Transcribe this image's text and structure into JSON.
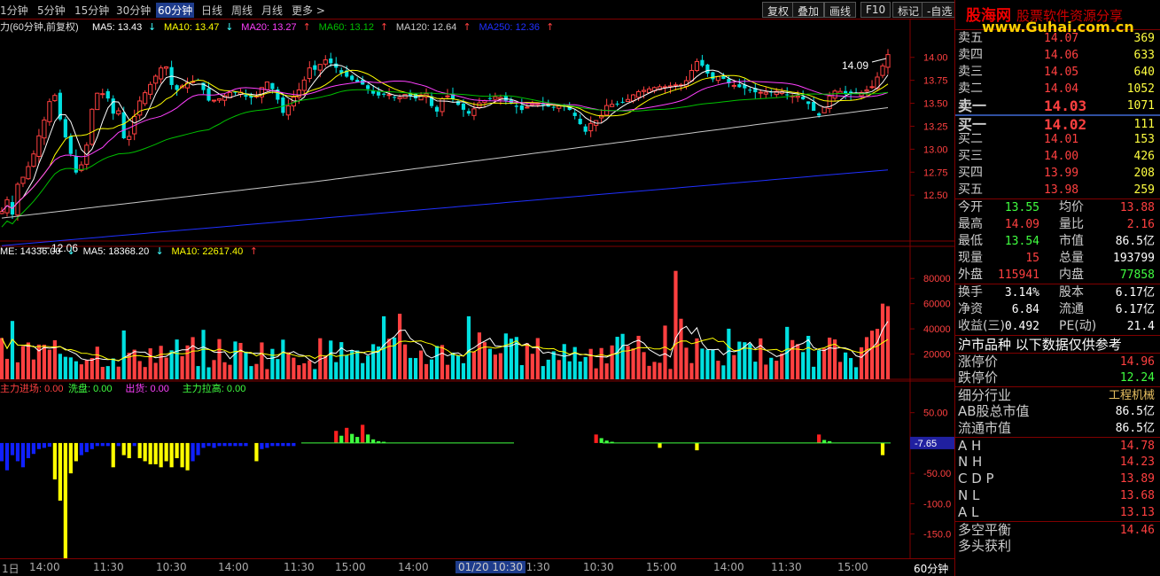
{
  "toolbar": {
    "periods": [
      "1分钟",
      "5分钟",
      "15分钟",
      "30分钟",
      "60分钟",
      "日线",
      "周线",
      "月线",
      "更多 >"
    ],
    "selected_period": "60分钟",
    "buttons": [
      "复权",
      "叠加",
      "画线",
      "F10",
      "标记",
      "-自选"
    ]
  },
  "colors": {
    "up": "#ff4040",
    "down": "#00e0e0",
    "ma5": "#ffffff",
    "ma10": "#ffff00",
    "ma20": "#ff40ff",
    "ma60": "#00c000",
    "ma120": "#c8c8c8",
    "ma250": "#2030ff",
    "bg": "#000000",
    "grid": "#800000"
  },
  "price_header": {
    "title": "力(60分钟,前复权)",
    "items": [
      {
        "label": "MA5: 13.43",
        "arrow": "↓",
        "color": "#ffffff"
      },
      {
        "label": "MA10: 13.47",
        "arrow": "↓",
        "color": "#ffff00"
      },
      {
        "label": "MA20: 13.27",
        "arrow": "↑",
        "color": "#ff40ff"
      },
      {
        "label": "MA60: 13.12",
        "arrow": "↑",
        "color": "#00c000"
      },
      {
        "label": "MA120: 12.64",
        "arrow": "↑",
        "color": "#c8c8c8"
      },
      {
        "label": "MA250: 12.36",
        "arrow": "↑",
        "color": "#2030ff"
      }
    ]
  },
  "volume_header": {
    "items": [
      {
        "label": "ME: 14336.00",
        "arrow": "↓",
        "color": "#ffffff"
      },
      {
        "label": "MA5: 18368.20",
        "arrow": "↓",
        "color": "#ffffff"
      },
      {
        "label": "MA10: 22617.40",
        "arrow": "↑",
        "color": "#ffff00"
      }
    ]
  },
  "indicator_header": {
    "items": [
      {
        "label": "主力进场: 0.00",
        "color": "#ff4040"
      },
      {
        "label": "洗盘: 0.00",
        "color": "#40ff40"
      },
      {
        "label": "出货: 0.00",
        "color": "#ff40ff"
      },
      {
        "label": "主力拉高: 0.00",
        "color": "#40ff40"
      }
    ]
  },
  "indicator_current": "-7.65",
  "price_axis": [
    "14.00",
    "13.75",
    "13.50",
    "13.25",
    "13.00",
    "12.75",
    "12.50"
  ],
  "volume_axis": [
    "80000",
    "60000",
    "40000",
    "20000"
  ],
  "indicator_axis": [
    "50.00",
    "-50.00",
    "-100.0",
    "-150.0"
  ],
  "annotations": {
    "high": "14.09",
    "low": "12.06"
  },
  "time_axis": [
    "1日",
    "14:00",
    "11:30",
    "10:30",
    "14:00",
    "11:30",
    "15:00",
    "14:00",
    "15:00",
    "11:30",
    "10:30",
    "15:00",
    "14:00",
    "11:30",
    "15:00"
  ],
  "cursor_time": "01/20 10:30",
  "period_label": "60分钟",
  "chart_data": {
    "type": "candlestick",
    "period": "60分钟",
    "ylim": [
      12.0,
      14.2
    ],
    "volume_ylim": [
      0,
      90000
    ],
    "indicator_ylim": [
      -190,
      70
    ],
    "high": 14.09,
    "low": 12.06,
    "ma_last": {
      "MA5": 13.43,
      "MA10": 13.47,
      "MA20": 13.27,
      "MA60": 13.12,
      "MA120": 12.64,
      "MA250": 12.36
    },
    "volume_last": 14336,
    "volume_ma5": 18368.2,
    "volume_ma10": 22617.4
  },
  "panel": {
    "logo": {
      "brand": "股海网",
      "slogan": "股票软件资源分享",
      "url": "www.Guhai.com.cn"
    },
    "order_book": [
      {
        "label": "卖五",
        "price": "14.07",
        "vol": "369"
      },
      {
        "label": "卖四",
        "price": "14.06",
        "vol": "633"
      },
      {
        "label": "卖三",
        "price": "14.05",
        "vol": "640"
      },
      {
        "label": "卖二",
        "price": "14.04",
        "vol": "1052"
      },
      {
        "label": "卖一",
        "price": "14.03",
        "vol": "1071",
        "big": true
      },
      {
        "label": "买一",
        "price": "14.02",
        "vol": "111",
        "big": true
      },
      {
        "label": "买二",
        "price": "14.01",
        "vol": "153"
      },
      {
        "label": "买三",
        "price": "14.00",
        "vol": "426"
      },
      {
        "label": "买四",
        "price": "13.99",
        "vol": "208"
      },
      {
        "label": "买五",
        "price": "13.98",
        "vol": "259"
      }
    ],
    "quote": [
      {
        "l": "今开",
        "v": "13.55",
        "vc": "green",
        "l2": "均价",
        "v2": "13.88",
        "v2c": "red"
      },
      {
        "l": "最高",
        "v": "14.09",
        "vc": "red",
        "l2": "量比",
        "v2": "2.16",
        "v2c": "red"
      },
      {
        "l": "最低",
        "v": "13.54",
        "vc": "green",
        "l2": "市值",
        "v2": "86.5亿",
        "v2c": "white"
      },
      {
        "l": "现量",
        "v": "15",
        "vc": "red",
        "l2": "总量",
        "v2": "193799",
        "v2c": "white"
      },
      {
        "l": "外盘",
        "v": "115941",
        "vc": "red",
        "l2": "内盘",
        "v2": "77858",
        "v2c": "green"
      }
    ],
    "quote2": [
      {
        "l": "换手",
        "v": "3.14%",
        "vc": "white",
        "l2": "股本",
        "v2": "6.17亿",
        "v2c": "white"
      },
      {
        "l": "净资",
        "v": "6.84",
        "vc": "white",
        "l2": "流通",
        "v2": "6.17亿",
        "v2c": "white"
      },
      {
        "l": "收益(三)",
        "v": "0.492",
        "vc": "white",
        "l2": "PE(动)",
        "v2": "21.4",
        "v2c": "white"
      }
    ],
    "section_header": "沪市品种  以下数据仅供参考",
    "limits": [
      {
        "l": "涨停价",
        "v": "14.96",
        "vc": "red"
      },
      {
        "l": "跌停价",
        "v": "12.24",
        "vc": "green"
      }
    ],
    "industry": {
      "l": "细分行业",
      "v": "工程机械"
    },
    "caps": [
      {
        "l": "AB股总市值",
        "v": "86.5亿"
      },
      {
        "l": "流通市值",
        "v": "86.5亿"
      }
    ],
    "levels": [
      {
        "l": "A H",
        "v": "14.78"
      },
      {
        "l": "N H",
        "v": "14.23"
      },
      {
        "l": "C D P",
        "v": "13.89"
      },
      {
        "l": "N L",
        "v": "13.68"
      },
      {
        "l": "A L",
        "v": "13.13"
      }
    ],
    "bottom": [
      {
        "l": "多空平衡",
        "v": "14.46"
      },
      {
        "l": "多头获利",
        "v": ""
      }
    ]
  }
}
